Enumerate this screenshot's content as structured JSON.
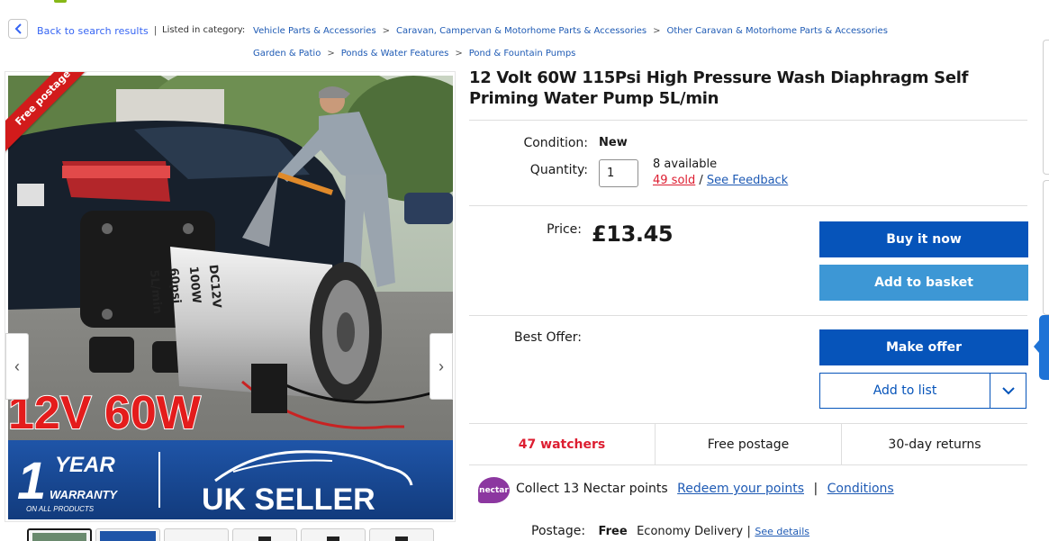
{
  "breadcrumb": {
    "back_label": "Back to search results",
    "separator": "|",
    "listed_in": "Listed in category:",
    "row1": [
      "Vehicle Parts & Accessories",
      "Caravan, Campervan & Motorhome Parts & Accessories",
      "Other Caravan & Motorhome Parts & Accessories"
    ],
    "row2": [
      "Garden & Patio",
      "Ponds & Water Features",
      "Pond & Fountain Pumps"
    ],
    "arrow": ">"
  },
  "gallery": {
    "ribbon": "Free postage",
    "image_text": {
      "main": "12V 60W",
      "warranty_big": "1",
      "warranty_year": "YEAR",
      "warranty": "WARRANTY",
      "warranty_small": "ON ALL PRODUCTS",
      "uk_seller": "UK SELLER",
      "pump_label": "DC12V 100W 60psi 5L/min"
    },
    "prev_icon": "chevron-left-icon",
    "next_icon": "chevron-right-icon",
    "thumb_count": 6
  },
  "product": {
    "title": "12 Volt 60W 115Psi High Pressure Wash Diaphragm Self Priming Water Pump 5L/min",
    "condition_label": "Condition:",
    "condition_value": "New",
    "quantity_label": "Quantity:",
    "quantity_value": "1",
    "available": "8 available",
    "sold": "49 sold",
    "sold_sep": " / ",
    "feedback": "See Feedback",
    "price_label": "Price:",
    "price": "£13.45",
    "best_offer_label": "Best Offer:"
  },
  "actions": {
    "buy_now": "Buy it now",
    "add_to_basket": "Add to basket",
    "make_offer": "Make offer",
    "add_to_list": "Add to list"
  },
  "stats": {
    "watchers": "47 watchers",
    "postage": "Free postage",
    "returns": "30-day returns"
  },
  "nectar": {
    "logo": "nectar",
    "text": "Collect 13 Nectar points",
    "redeem": "Redeem your points",
    "sep": "|",
    "conditions": "Conditions"
  },
  "postage": {
    "label": "Postage:",
    "free": "Free",
    "service": "Economy Delivery",
    "sep": "|",
    "details": "See details"
  },
  "colors": {
    "primary": "#0654ba",
    "secondary": "#3d97d5",
    "link": "#1e5ab4",
    "alert_red": "#dd1e31",
    "ribbon_red": "#d21b1b",
    "nectar_purple": "#8c37a0"
  }
}
